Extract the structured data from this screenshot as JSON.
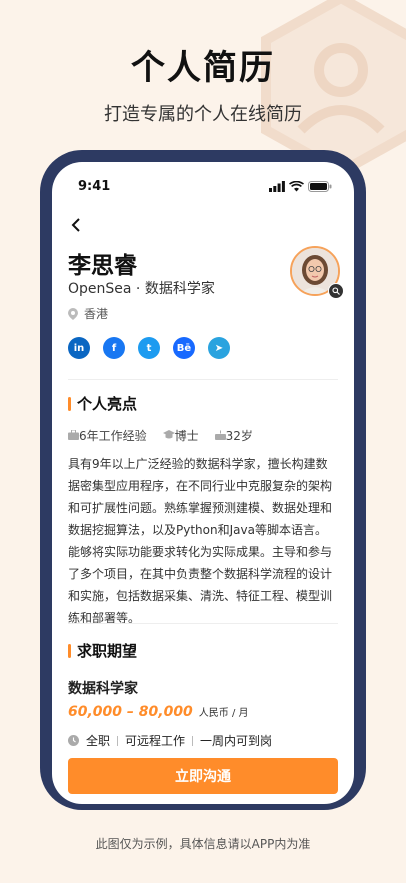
{
  "hero": {
    "title": "个人简历",
    "subtitle": "打造专属的个人在线简历"
  },
  "status_bar": {
    "time": "9:41"
  },
  "profile": {
    "name": "李思睿",
    "role": "OpenSea · 数据科学家",
    "location": "香港"
  },
  "socials": [
    {
      "name": "linkedin-icon",
      "glyph": "in",
      "color": "#0a66c2"
    },
    {
      "name": "facebook-icon",
      "glyph": "f",
      "color": "#1877f2"
    },
    {
      "name": "twitter-icon",
      "glyph": "t",
      "color": "#1d9bf0"
    },
    {
      "name": "behance-icon",
      "glyph": "Bē",
      "color": "#1769ff"
    },
    {
      "name": "telegram-icon",
      "glyph": "➤",
      "color": "#2aa3df"
    }
  ],
  "highlights": {
    "title": "个人亮点",
    "experience": "6年工作经验",
    "degree": "博士",
    "age": "32岁",
    "bio": "具有9年以上广泛经验的数据科学家，擅长构建数据密集型应用程序，在不同行业中克服复杂的架构和可扩展性问题。熟练掌握预测建模、数据处理和数据挖掘算法，以及Python和Java等脚本语言。能够将实际功能要求转化为实际成果。主导和参与了多个项目，在其中负责整个数据科学流程的设计和实施，包括数据采集、清洗、特征工程、模型训练和部署等。"
  },
  "expectation": {
    "title": "求职期望",
    "job": "数据科学家",
    "salary": "60,000 – 80,000",
    "salary_unit": "人民币 / 月",
    "tags": [
      "全职",
      "可远程工作",
      "一周内可到岗"
    ]
  },
  "cta": {
    "label": "立即沟通"
  },
  "footnote": "此图仅为示例，具体信息请以APP内为准",
  "colors": {
    "accent": "#ff8c2a",
    "phone_frame": "#2d3a62",
    "background": "#fcf3ea"
  }
}
